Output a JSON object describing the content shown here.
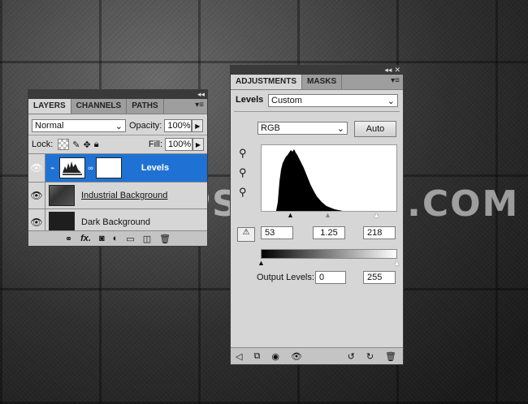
{
  "watermark": "WWW.PSD-DUDE.COM",
  "layers_panel": {
    "tabs": [
      "LAYERS",
      "CHANNELS",
      "PATHS"
    ],
    "blend_mode": "Normal",
    "opacity_label": "Opacity:",
    "opacity_value": "100%",
    "lock_label": "Lock:",
    "fill_label": "Fill:",
    "fill_value": "100%",
    "layers": [
      {
        "name": "Levels",
        "selected": true
      },
      {
        "name": "Industrial Background",
        "selected": false
      },
      {
        "name": "Dark Background",
        "selected": false
      }
    ],
    "bottom_icons": [
      "link-icon",
      "fx-icon",
      "mask-icon",
      "adjustment-icon",
      "folder-icon",
      "new-layer-icon",
      "trash-icon"
    ],
    "fx_label": "fx."
  },
  "adjust_panel": {
    "tabs": [
      "ADJUSTMENTS",
      "MASKS"
    ],
    "title": "Levels",
    "preset": "Custom",
    "channel": "RGB",
    "auto_label": "Auto",
    "input_black": "53",
    "input_gamma": "1.25",
    "input_white": "218",
    "output_label": "Output Levels:",
    "output_black": "0",
    "output_white": "255"
  },
  "colors": {
    "selection": "#1f72d4",
    "panel": "#d6d6d6",
    "panel_dark": "#3a3a3a"
  }
}
